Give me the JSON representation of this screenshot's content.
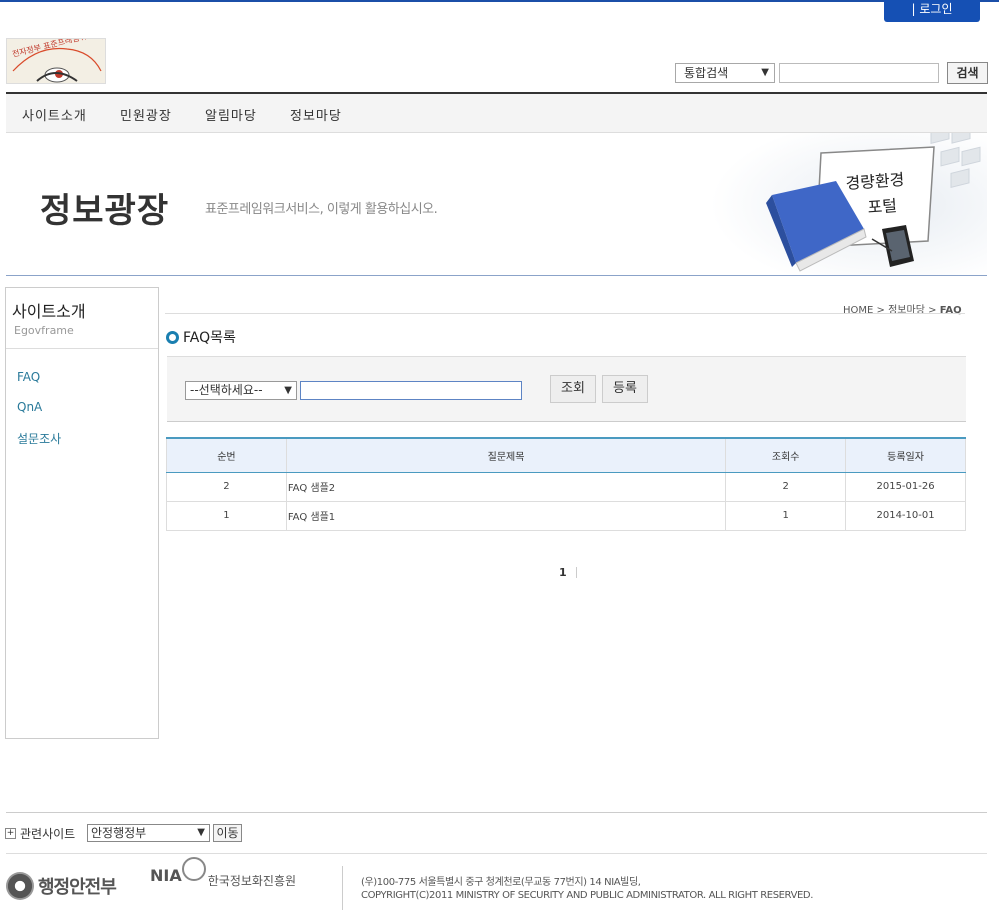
{
  "header": {
    "login_label": "| 로그인",
    "logo_alt": "전자정부 표준프레임워크",
    "search_scope": "통합검색",
    "search_button": "검색"
  },
  "gnb": {
    "items": [
      "사이트소개",
      "민원광장",
      "알림마당",
      "정보마당"
    ]
  },
  "visual": {
    "title": "정보광장",
    "subtitle": "표준프레임워크서비스, 이렇게 활용하십시오.",
    "board_text_1": "경량환경",
    "board_text_2": "포털"
  },
  "lnb": {
    "title": "사이트소개",
    "subtitle": "Egovframe",
    "items": [
      "FAQ",
      "QnA",
      "설문조사"
    ]
  },
  "breadcrumb": {
    "home": "HOME",
    "sep": ">",
    "level1": "정보마당",
    "current": "FAQ"
  },
  "page": {
    "title": "FAQ목록"
  },
  "search": {
    "condition": "--선택하세요--",
    "keyword": "",
    "query_button": "조회",
    "register_button": "등록"
  },
  "table": {
    "headers": [
      "순번",
      "질문제목",
      "조회수",
      "등록일자"
    ],
    "rows": [
      {
        "no": "2",
        "title": "FAQ 샘플2",
        "views": "2",
        "date": "2015-01-26"
      },
      {
        "no": "1",
        "title": "FAQ 샘플1",
        "views": "1",
        "date": "2014-10-01"
      }
    ]
  },
  "pagination": {
    "current": "1"
  },
  "footer": {
    "related_label": "관련사이트",
    "related_selected": "안정행정부",
    "go_button": "이동",
    "org1": "행정안전부",
    "org2_short": "NIA",
    "org2": "한국정보화진흥원",
    "address": "(우)100-775 서울특별시 중구 청계천로(무교동 77번지) 14 NIA빌딩,",
    "copyright": "COPYRIGHT(C)2011 MINISTRY OF SECURITY AND PUBLIC ADMINISTRATOR. ALL RIGHT RESERVED."
  }
}
